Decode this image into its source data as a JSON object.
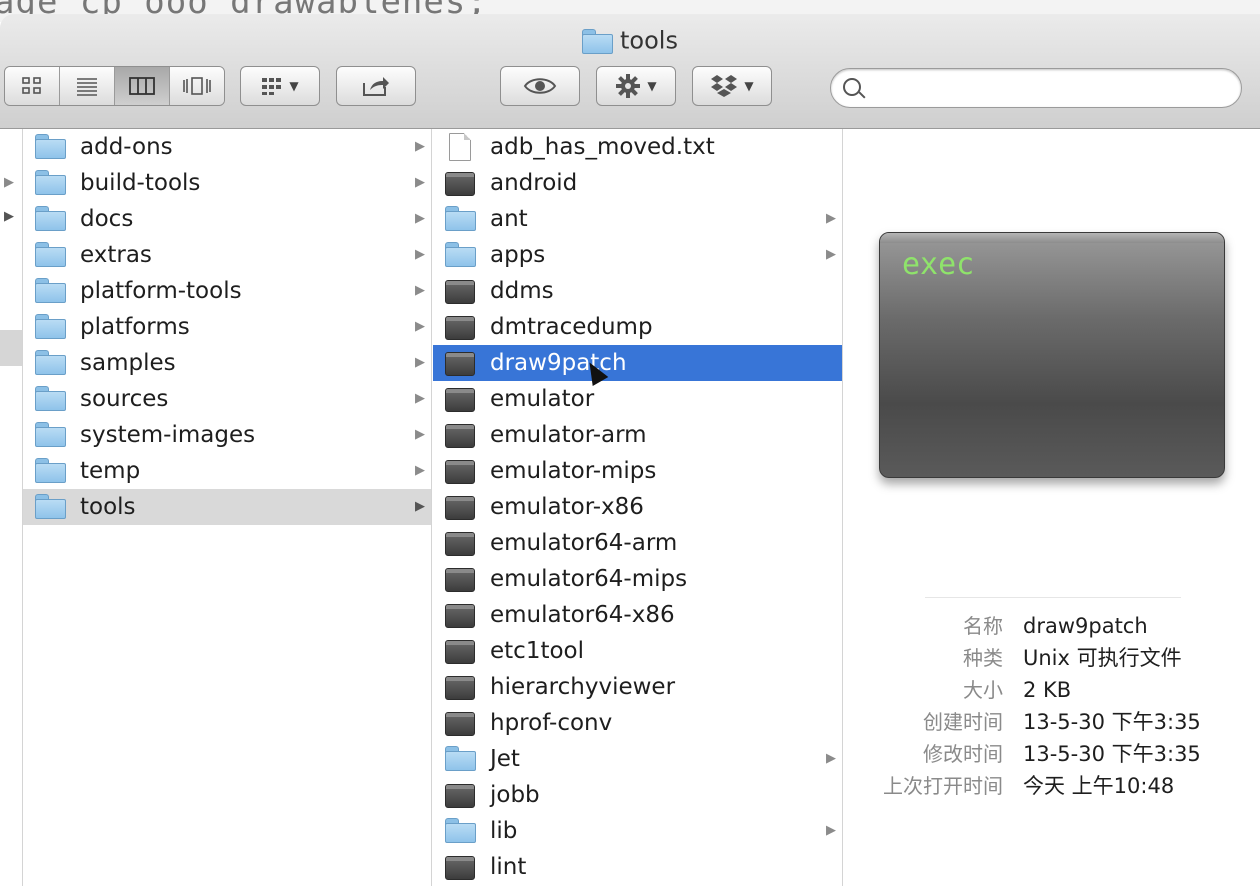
{
  "background_terminal_text": "age cp ooo drawablenes;",
  "window": {
    "title": "tools"
  },
  "toolbar": {
    "view_icon": "icon-view-button",
    "list_icon": "list-view-button",
    "column_icon": "column-view-button",
    "coverflow_icon": "coverflow-view-button",
    "arrange_icon": "grid-arrange-icon",
    "share_icon": "share-icon",
    "quicklook_icon": "eye-icon",
    "action_icon": "gear-icon",
    "dropbox_icon": "dropbox-icon",
    "search_placeholder": ""
  },
  "column1": {
    "selected": "tools",
    "items": [
      {
        "label": "add-ons",
        "has_children": true
      },
      {
        "label": "build-tools",
        "has_children": true
      },
      {
        "label": "docs",
        "has_children": true
      },
      {
        "label": "extras",
        "has_children": true
      },
      {
        "label": "platform-tools",
        "has_children": true
      },
      {
        "label": "platforms",
        "has_children": true
      },
      {
        "label": "samples",
        "has_children": true
      },
      {
        "label": "sources",
        "has_children": true
      },
      {
        "label": "system-images",
        "has_children": true
      },
      {
        "label": "temp",
        "has_children": true
      },
      {
        "label": "tools",
        "has_children": true
      }
    ]
  },
  "column2": {
    "selected": "draw9patch",
    "items": [
      {
        "label": "adb_has_moved.txt",
        "type": "document"
      },
      {
        "label": "android",
        "type": "exec"
      },
      {
        "label": "ant",
        "type": "folder"
      },
      {
        "label": "apps",
        "type": "folder"
      },
      {
        "label": "ddms",
        "type": "exec"
      },
      {
        "label": "dmtracedump",
        "type": "exec"
      },
      {
        "label": "draw9patch",
        "type": "exec"
      },
      {
        "label": "emulator",
        "type": "exec"
      },
      {
        "label": "emulator-arm",
        "type": "exec"
      },
      {
        "label": "emulator-mips",
        "type": "exec"
      },
      {
        "label": "emulator-x86",
        "type": "exec"
      },
      {
        "label": "emulator64-arm",
        "type": "exec"
      },
      {
        "label": "emulator64-mips",
        "type": "exec"
      },
      {
        "label": "emulator64-x86",
        "type": "exec"
      },
      {
        "label": "etc1tool",
        "type": "exec"
      },
      {
        "label": "hierarchyviewer",
        "type": "exec"
      },
      {
        "label": "hprof-conv",
        "type": "exec"
      },
      {
        "label": "Jet",
        "type": "folder"
      },
      {
        "label": "jobb",
        "type": "exec"
      },
      {
        "label": "lib",
        "type": "folder"
      },
      {
        "label": "lint",
        "type": "exec"
      }
    ]
  },
  "preview": {
    "icon_text": "exec",
    "info": [
      {
        "key": "名称",
        "value": "draw9patch"
      },
      {
        "key": "种类",
        "value": "Unix 可执行文件"
      },
      {
        "key": "大小",
        "value": "2 KB"
      },
      {
        "key": "创建时间",
        "value": "13-5-30 下午3:35"
      },
      {
        "key": "修改时间",
        "value": "13-5-30 下午3:35"
      },
      {
        "key": "上次打开时间",
        "value": "今天 上午10:48"
      }
    ]
  },
  "colors": {
    "selection_blue": "#3875d7",
    "selection_gray": "#d9d9d9",
    "exec_text_green": "#8fe36b"
  }
}
